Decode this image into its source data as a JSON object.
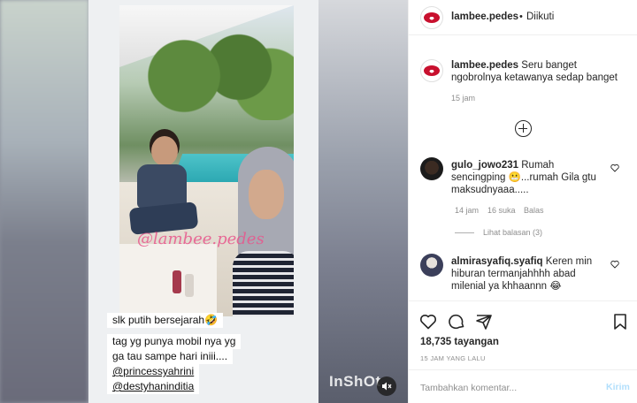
{
  "post": {
    "author": "lambee.pedes",
    "follow_status": "Diikuti",
    "separator": "•",
    "caption_user": "lambee.pedes",
    "caption_text": "Seru banget ngobrolnya ketawanya sedap banget",
    "caption_time": "15 jam"
  },
  "story": {
    "watermark": "@lambee.pedes",
    "lines": [
      "slk putih bersejarah🤣",
      "tag yg punya mobil nya yg",
      "ga tau sampe hari iniii....",
      "@princessyahrini",
      "@destyhaninditia"
    ],
    "app_watermark": "InShOt"
  },
  "comments": [
    {
      "user": "gulo_jowo231",
      "text": "Rumah sencingping 😬...rumah Gila gtu maksudnyaaa.....",
      "time": "14 jam",
      "likes": "16 suka",
      "reply": "Balas",
      "view_replies": "Lihat balasan (3)"
    },
    {
      "user": "almirasyafiq.syafiq",
      "text": "Keren min hiburan termanjahhhh abad milenial ya khhaannn 😂"
    }
  ],
  "stats": {
    "views": "18,735 tayangan",
    "posted": "15 JAM YANG LALU"
  },
  "composer": {
    "placeholder": "Tambahkan komentar...",
    "send_label": "Kirim"
  },
  "colors": {
    "brand_red": "#c8102e",
    "send_disabled": "#b2dffc",
    "muted": "#8e8e8e"
  }
}
